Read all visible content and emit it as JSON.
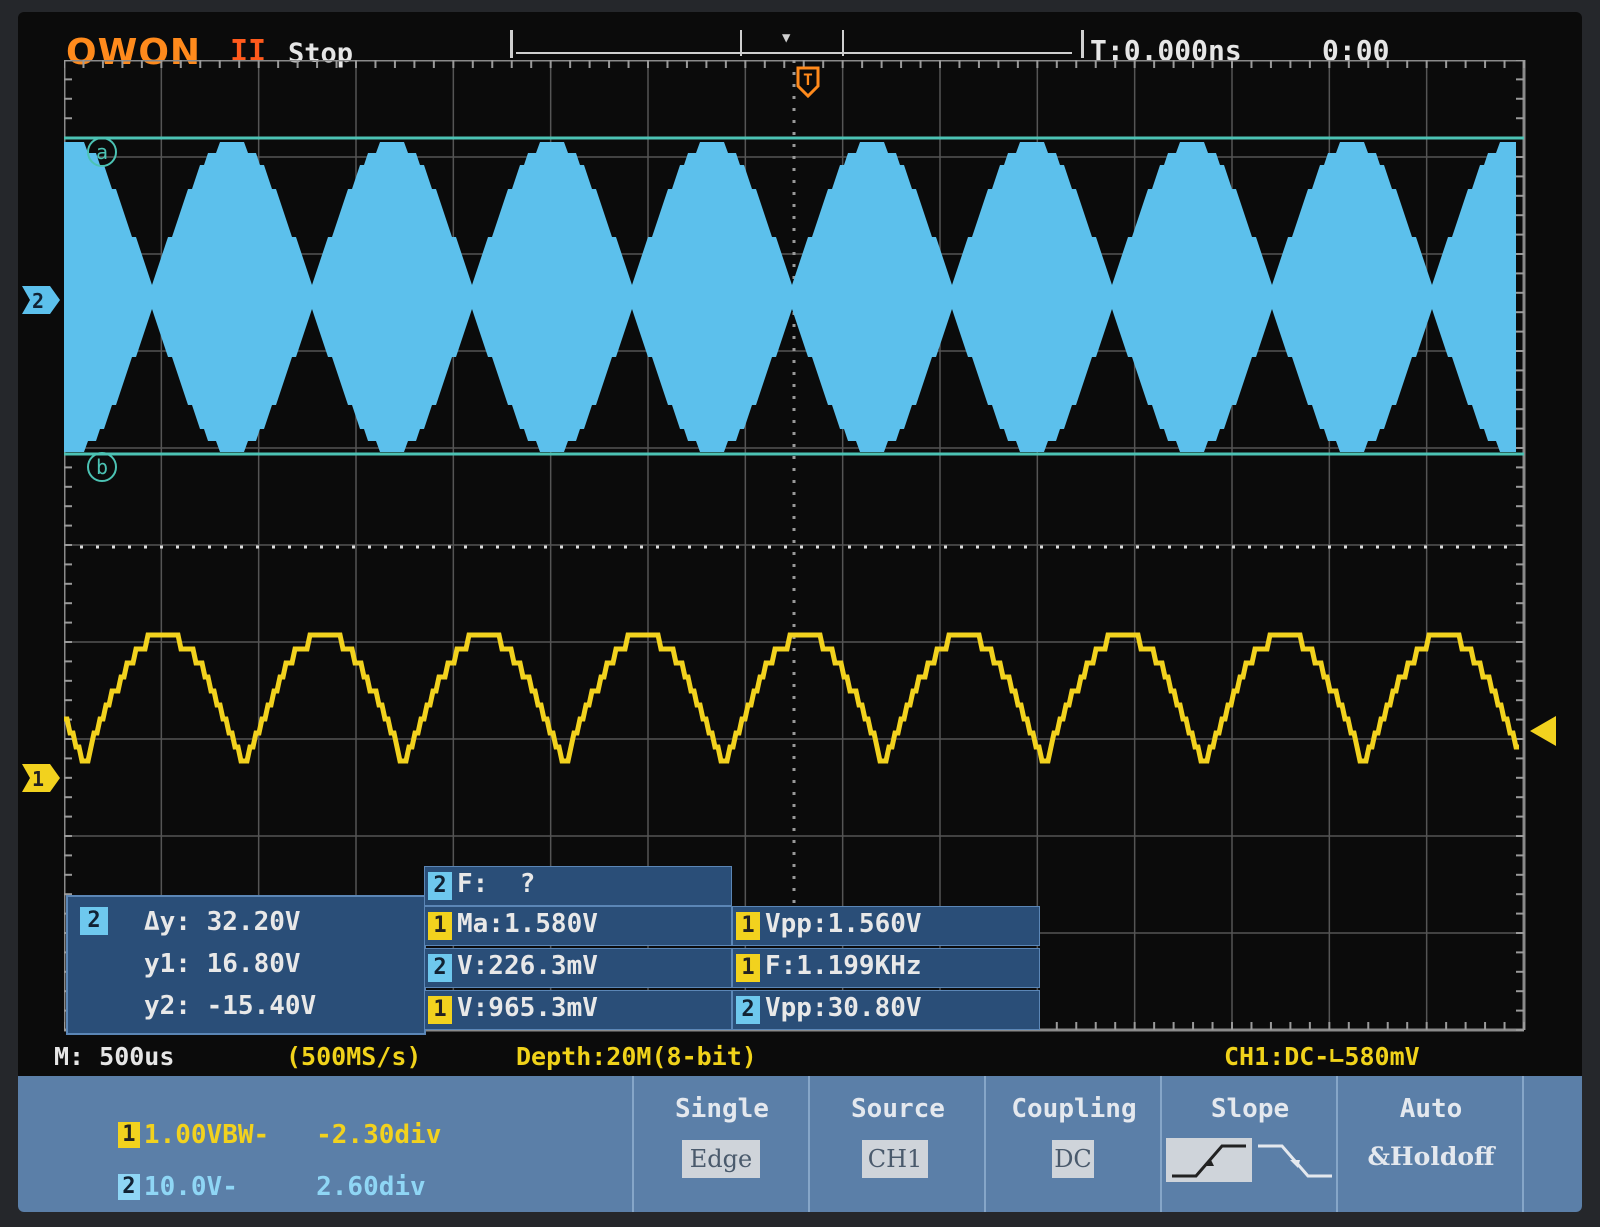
{
  "status": {
    "brand": "OWON",
    "pause_symbol": "II",
    "run_state": "Stop",
    "trigger_delay": "T:0.000ns",
    "clock": "0:00"
  },
  "markers": {
    "math_a": "a",
    "math_b": "b",
    "ch2": "2",
    "ch1": "1",
    "trigger": "T"
  },
  "cursor": {
    "channel": "2",
    "dy": "Δy: 32.20V",
    "y1": "y1: 16.80V",
    "y2": "y2: -15.40V"
  },
  "measurements": [
    {
      "channel": "2",
      "text": "F:  ?"
    },
    {
      "channel": "1",
      "text": "Ma:1.580V"
    },
    {
      "channel": "1",
      "text": "Vpp:1.560V"
    },
    {
      "channel": "2",
      "text": "V:226.3mV"
    },
    {
      "channel": "1",
      "text": "F:1.199KHz"
    },
    {
      "channel": "1",
      "text": "V:965.3mV"
    },
    {
      "channel": "2",
      "text": "Vpp:30.80V"
    }
  ],
  "info": {
    "timebase": "M: 500us",
    "sample_rate": "(500MS/s)",
    "depth": "Depth:20M(8-bit)",
    "trigger_info": "CH1:DC-∟580mV"
  },
  "channels": [
    {
      "tag": "1",
      "scale": "1.00VBW-",
      "offset": "-2.30div"
    },
    {
      "tag": "2",
      "scale": "10.0V-",
      "offset": "2.60div"
    }
  ],
  "menu": {
    "mode_label": "Single",
    "mode_value": "Edge",
    "source_label": "Source",
    "source_value": "CH1",
    "coupling_label": "Coupling",
    "coupling_value": "DC",
    "slope_label": "Slope",
    "holdoff_label": "Auto",
    "holdoff_value": "&Holdoff"
  },
  "colors": {
    "ch1": "#f2d21e",
    "ch2": "#5cc0ec",
    "accent": "#ff8a1c",
    "panel": "#2a4e78",
    "menu": "#5b7fa8"
  }
}
